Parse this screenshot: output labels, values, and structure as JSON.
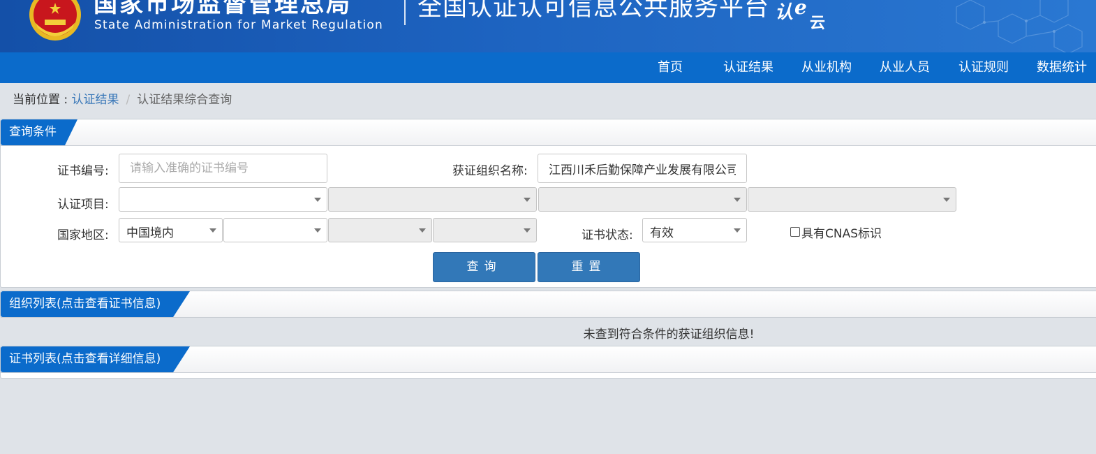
{
  "header": {
    "agency_cn": "国家市场监督管理总局",
    "agency_en": "State Administration  for  Market Regulation",
    "platform_title": "全国认证认可信息公共服务平台",
    "logo_text": "认e云",
    "brand_color": "#0b6bcb"
  },
  "nav": {
    "items": [
      "首页",
      "认证结果",
      "从业机构",
      "从业人员",
      "认证规则",
      "数据统计"
    ]
  },
  "breadcrumb": {
    "prefix": "当前位置 : ",
    "link": "认证结果",
    "separator": "/",
    "current": "认证结果综合查询"
  },
  "query_panel": {
    "title": "查询条件",
    "cert_no_label": "证书编号:",
    "cert_no_placeholder": "请输入准确的证书编号",
    "cert_no_value": "",
    "org_name_label": "获证组织名称:",
    "org_name_value": "江西川禾后勤保障产业发展有限公司",
    "cert_item_label": "认证项目:",
    "region_label": "国家地区:",
    "region_value": "中国境内",
    "status_label": "证书状态:",
    "status_value": "有效",
    "cnas_label": "具有CNAS标识",
    "cnas_checked": false,
    "search_button": "查询",
    "reset_button": "重置"
  },
  "org_panel": {
    "title": "组织列表(点击查看证书信息)",
    "empty_message": "未查到符合条件的获证组织信息!"
  },
  "cert_panel": {
    "title": "证书列表(点击查看详细信息)"
  }
}
